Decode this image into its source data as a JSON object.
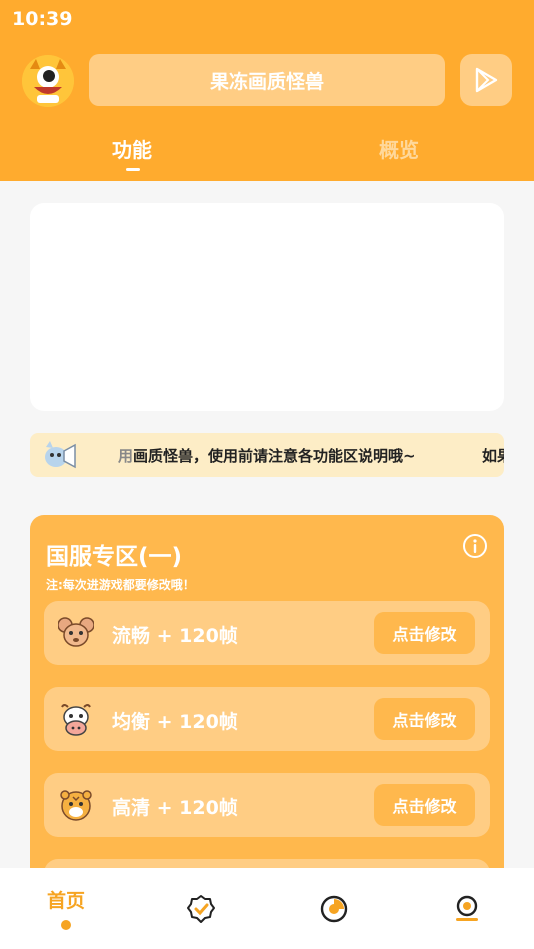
{
  "status_bar": {
    "time": "10:39"
  },
  "header": {
    "title": "果冻画质怪兽",
    "avatar_icon": "monster-avatar",
    "play_icon": "play-store-icon"
  },
  "tabs": [
    {
      "label": "功能",
      "active": true
    },
    {
      "label": "概览",
      "active": false
    }
  ],
  "notice": {
    "icon": "megaphone-mascot-icon",
    "text_dim": "用",
    "text": "画质怪兽，使用前请注意各功能区说明哦~",
    "tail": "如果"
  },
  "zone": {
    "title": "国服专区(一)",
    "note": "注:每次进游戏都要修改哦！",
    "info_icon": "info-icon",
    "options": [
      {
        "icon": "mouse-icon",
        "label": "流畅 + 120帧",
        "button": "点击修改"
      },
      {
        "icon": "cow-icon",
        "label": "均衡 + 120帧",
        "button": "点击修改"
      },
      {
        "icon": "tiger-icon",
        "label": "高清 + 120帧",
        "button": "点击修改"
      }
    ]
  },
  "bottom_nav": {
    "home_label": "首页",
    "items": [
      "home",
      "badge-check-icon",
      "chart-pie-icon",
      "profile-icon"
    ]
  },
  "colors": {
    "header": "#ffab2e",
    "zone": "#ffb84d",
    "zone_light": "#ffcd84",
    "accent": "#f6a422"
  }
}
